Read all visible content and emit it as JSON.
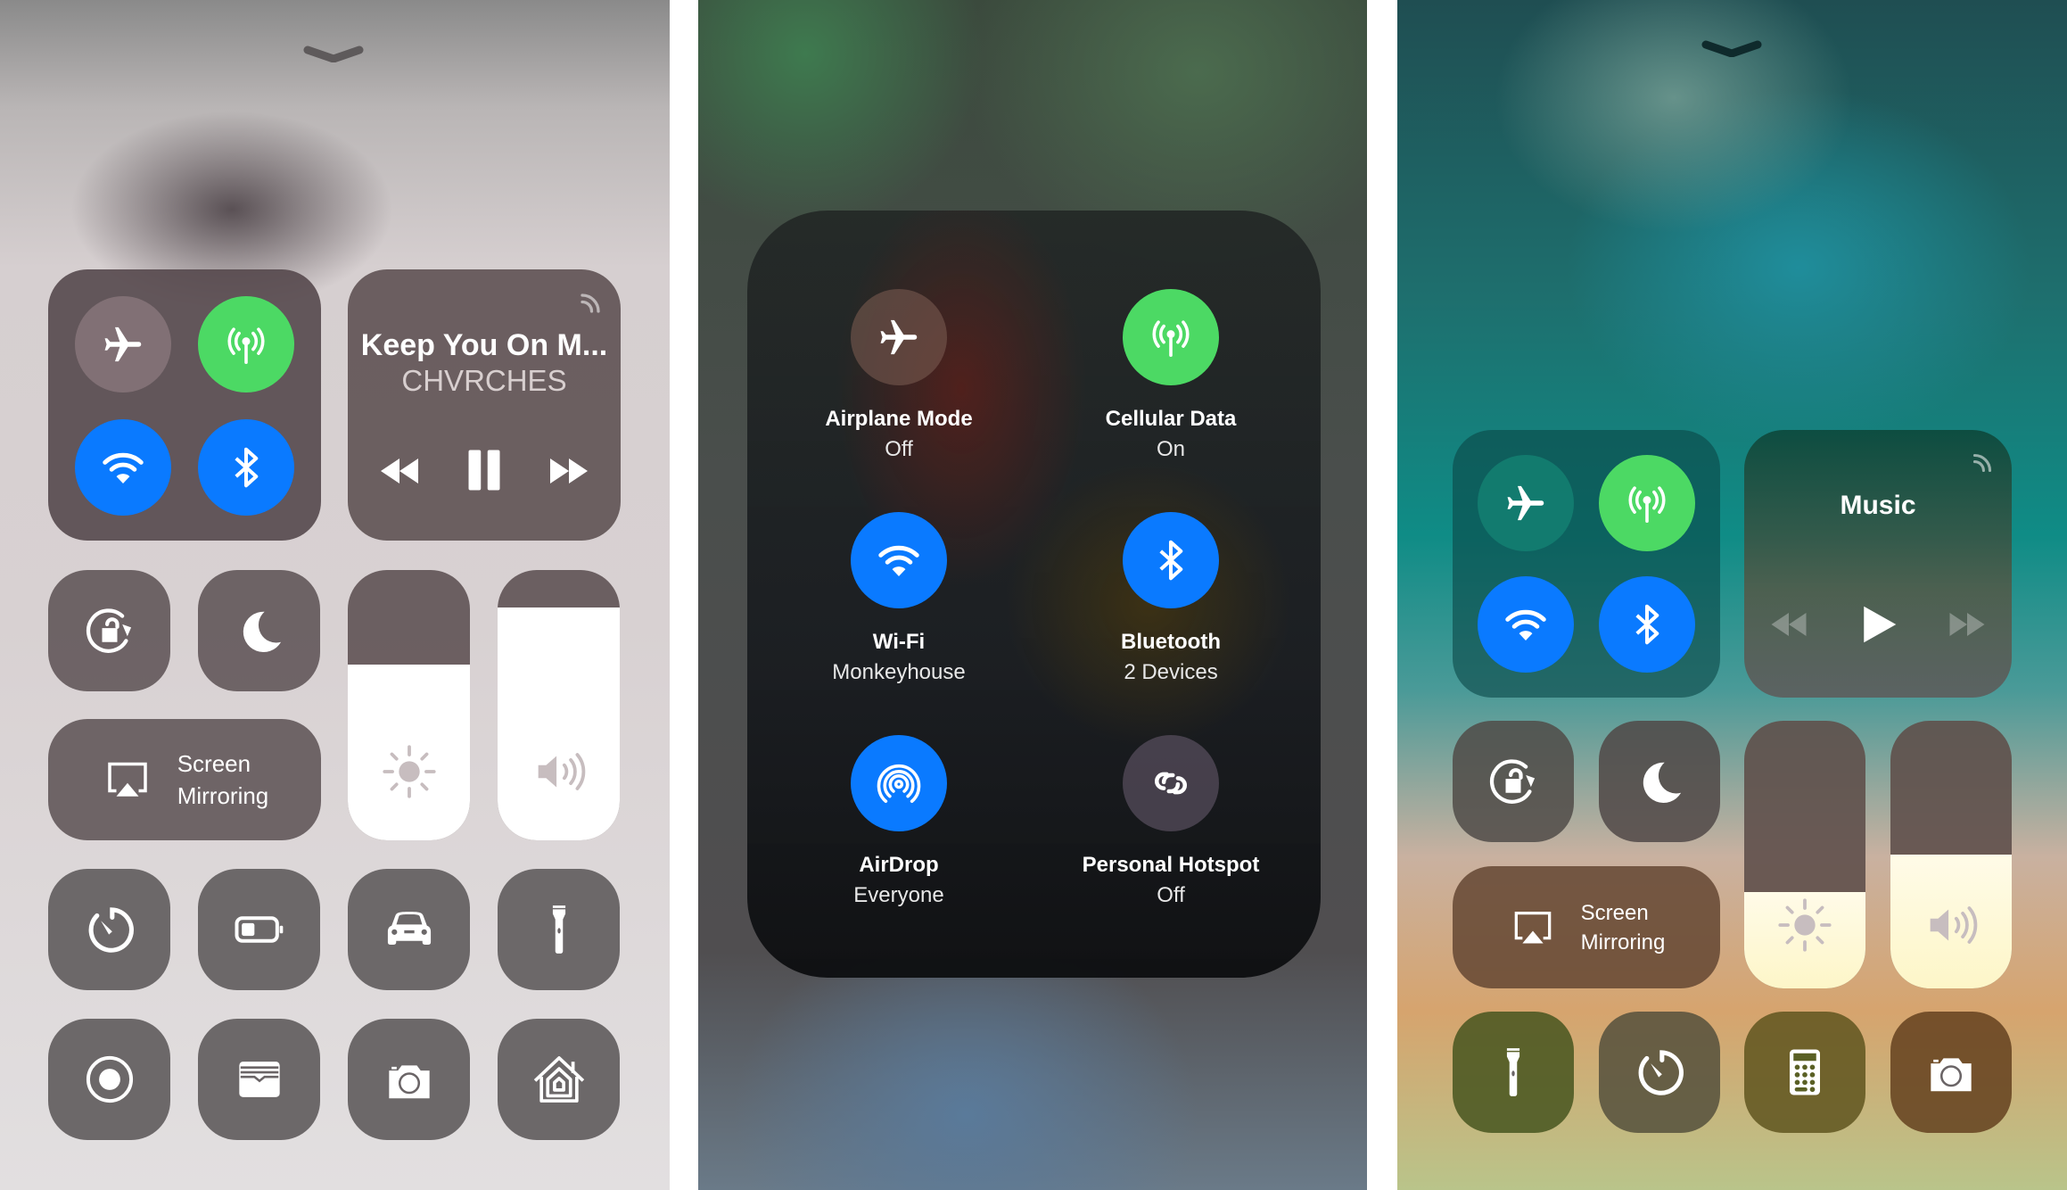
{
  "colors": {
    "green": "#4cd964",
    "blue": "#0a7aff",
    "tile": "#5a5052"
  },
  "panel1": {
    "connectivity": [
      {
        "name": "airplane-mode",
        "icon": "airplane-icon",
        "state": "off"
      },
      {
        "name": "cellular-data",
        "icon": "antenna-icon",
        "state": "on"
      },
      {
        "name": "wifi",
        "icon": "wifi-icon",
        "state": "on"
      },
      {
        "name": "bluetooth",
        "icon": "bluetooth-icon",
        "state": "on"
      }
    ],
    "music": {
      "title": "Keep You On M...",
      "artist": "CHVRCHES",
      "state": "playing",
      "airplay_icon": "airplay-audio-icon"
    },
    "screen_mirroring": {
      "line1": "Screen",
      "line2": "Mirroring"
    },
    "brightness": {
      "level": 0.65
    },
    "volume": {
      "level": 0.86
    },
    "tiles": [
      "timer-icon",
      "low-power-icon",
      "car-icon",
      "flashlight-icon",
      "screen-record-icon",
      "wallet-icon",
      "camera-icon",
      "home-icon"
    ]
  },
  "panel2": {
    "items": [
      {
        "label": "Airplane Mode",
        "status": "Off",
        "icon": "airplane-icon"
      },
      {
        "label": "Cellular Data",
        "status": "On",
        "icon": "antenna-icon"
      },
      {
        "label": "Wi-Fi",
        "status": "Monkeyhouse",
        "icon": "wifi-icon"
      },
      {
        "label": "Bluetooth",
        "status": "2 Devices",
        "icon": "bluetooth-icon"
      },
      {
        "label": "AirDrop",
        "status": "Everyone",
        "icon": "airdrop-icon"
      },
      {
        "label": "Personal Hotspot",
        "status": "Off",
        "icon": "hotspot-icon"
      }
    ]
  },
  "panel3": {
    "music": {
      "title": "Music",
      "state": "paused"
    },
    "screen_mirroring": {
      "line1": "Screen",
      "line2": "Mirroring"
    },
    "brightness": {
      "level": 0.36
    },
    "volume": {
      "level": 0.5
    },
    "tiles": [
      "flashlight-icon",
      "timer-icon",
      "calculator-icon",
      "camera-icon"
    ]
  }
}
